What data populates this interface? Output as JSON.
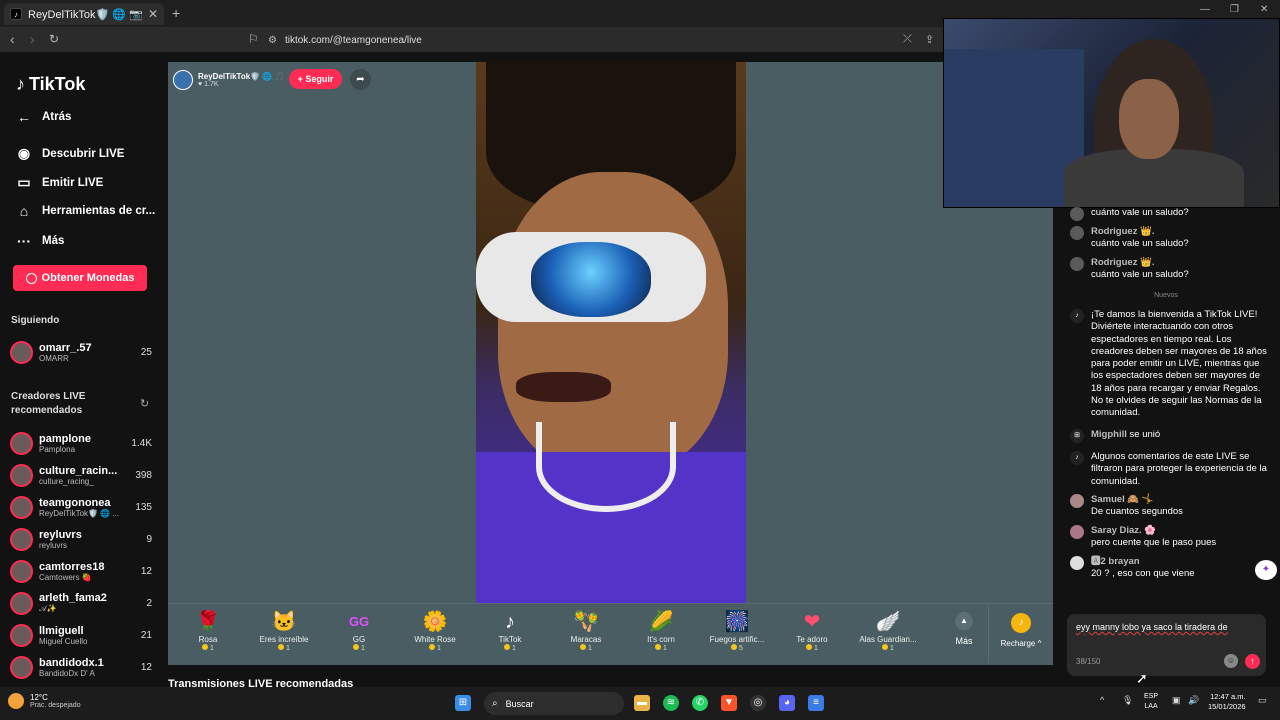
{
  "browser": {
    "tab_title": "ReyDelTikTok🛡️ 🌐 📷 (@te...",
    "tab_close": "✕",
    "new_tab": "+",
    "url": "tiktok.com/@teamgonenea/live"
  },
  "sidebar": {
    "logo": "TikTok",
    "nav": [
      {
        "label": "Atrás",
        "icon": "←"
      },
      {
        "label": "Descubrir LIVE",
        "icon": "◉"
      },
      {
        "label": "Emitir LIVE",
        "icon": "▭"
      },
      {
        "label": "Herramientas de cr...",
        "icon": "⌂"
      },
      {
        "label": "Más",
        "icon": "···"
      }
    ],
    "coins_button": "Obtener Monedas",
    "following_label": "Siguiendo",
    "following": [
      {
        "user": "omarr_.57",
        "name": "OMARR",
        "count": "25"
      }
    ],
    "recommended_label": "Creadores LIVE recomendados",
    "creators": [
      {
        "user": "pamplone",
        "name": "Pamplona",
        "count": "1.4K"
      },
      {
        "user": "culture_racin...",
        "name": "culture_racing_",
        "count": "398"
      },
      {
        "user": "teamgononea",
        "name": "ReyDelTikTok🛡️ 🌐 ...",
        "count": "135"
      },
      {
        "user": "reyluvrs",
        "name": "reyluvrs",
        "count": "9"
      },
      {
        "user": "camtorres18",
        "name": "Camtowers 🍓",
        "count": "12"
      },
      {
        "user": "arleth_fama2",
        "name": "𝒜✨",
        "count": "2"
      },
      {
        "user": "llmiguell",
        "name": "Miguel Cuello",
        "count": "21"
      },
      {
        "user": "bandidodx.1",
        "name": "BandidoDx D' A",
        "count": "12"
      }
    ]
  },
  "live": {
    "host_name": "ReyDelTikTok🛡️ 🌐 🎵",
    "host_likes": "♥ 1.7K",
    "follow_label": "+ Seguir",
    "bottom_section": "Transmisiones LIVE recomendadas"
  },
  "gifts": [
    {
      "name": "Rosa",
      "price": "1",
      "icon": "🌹"
    },
    {
      "name": "Eres increíble",
      "price": "1",
      "icon": "🐱"
    },
    {
      "name": "GG",
      "price": "1",
      "icon": "GG"
    },
    {
      "name": "White Rose",
      "price": "1",
      "icon": "🌼"
    },
    {
      "name": "TikTok",
      "price": "1",
      "icon": "♪"
    },
    {
      "name": "Maracas",
      "price": "1",
      "icon": "🪇"
    },
    {
      "name": "It's corn",
      "price": "1",
      "icon": "🌽"
    },
    {
      "name": "Fuegos artific...",
      "price": "5",
      "icon": "🎆"
    },
    {
      "name": "Te adoro",
      "price": "1",
      "icon": "❤"
    },
    {
      "name": "Alas Guardian...",
      "price": "1",
      "icon": "🪽"
    }
  ],
  "gift_more": "Más",
  "recharge": "Recharge ^",
  "chat": {
    "messages": [
      {
        "user": "",
        "text": "cuánto vale un saludo?"
      },
      {
        "user": "Rodriguez 👑.",
        "text": "cuánto vale un saludo?"
      },
      {
        "user": "Rodriguez 👑.",
        "text": "cuánto vale un saludo?"
      }
    ],
    "new_divider": "Nuevos",
    "welcome": "¡Te damos la bienvenida a TikTok LIVE! Diviértete interactuando con otros espectadores en tiempo real. Los creadores deben ser mayores de 18 años para poder emitir un LIVE, mientras que los espectadores deben ser mayores de 18 años para recargar y enviar Regalos. No te olvides de seguir las Normas de la comunidad.",
    "join_user": "Migphill",
    "join_text": "se unió",
    "filter_note": "Algunos comentarios de este LIVE se filtraron para proteger la experiencia de la comunidad.",
    "messages2": [
      {
        "user": "Samuel 🙈 🤸",
        "text": "De cuantos segundos"
      },
      {
        "user": "Saray Diaz. 🌸",
        "text": "pero cuente que le paso pues"
      },
      {
        "user": "🅰2 brayan",
        "text": "20 ? , eso con que viene"
      }
    ],
    "input_text": "eyy manny lobo ya saco la tiradera de",
    "char_count": "38/150"
  },
  "taskbar": {
    "temp": "12°C",
    "weather": "Prac. despejado",
    "search": "Buscar",
    "lang1": "ESP",
    "lang2": "LAA",
    "time": "12:47 a.m.",
    "date": "15/01/2026"
  }
}
